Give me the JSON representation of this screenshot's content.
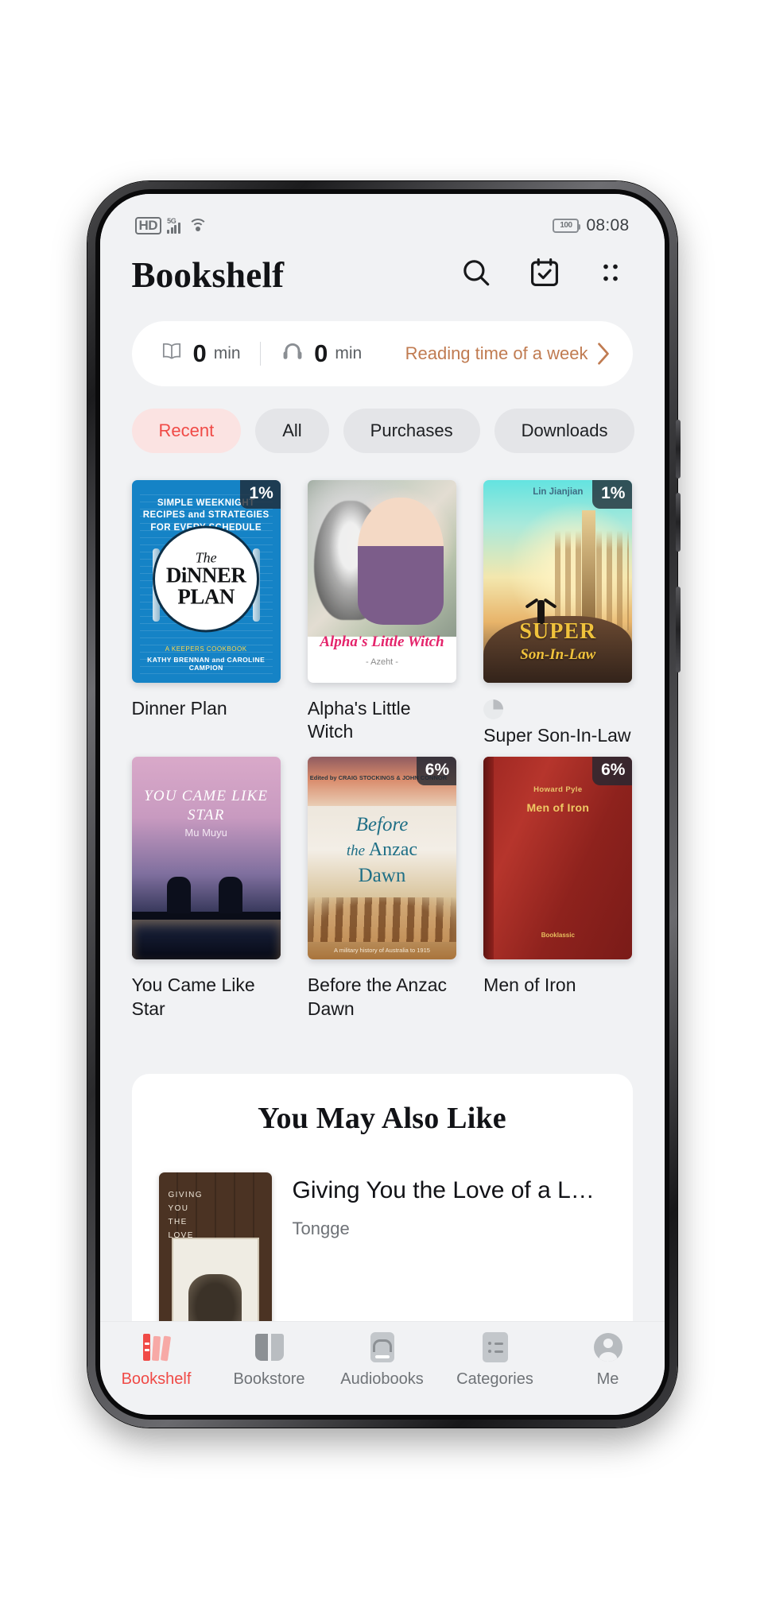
{
  "status_bar": {
    "hd": "HD",
    "network": "5G",
    "wifi_icon": "wifi-icon",
    "battery_level": "100",
    "time": "08:08"
  },
  "header": {
    "title": "Bookshelf",
    "icons": [
      {
        "name": "search-icon",
        "label": "Search"
      },
      {
        "name": "calendar-check-icon",
        "label": "Calendar"
      },
      {
        "name": "more-menu-icon",
        "label": "More"
      }
    ]
  },
  "reading_stats": {
    "read": {
      "value": "0",
      "unit": "min",
      "icon": "open-book-icon"
    },
    "listen": {
      "value": "0",
      "unit": "min",
      "icon": "headphones-icon"
    },
    "link_label": "Reading time of a week",
    "chevron": "chevron-right-icon",
    "accent_color": "#c07b51"
  },
  "filters": {
    "active_index": 0,
    "active_color": "#f04a46",
    "active_bg": "#fbe3e2",
    "items": [
      {
        "label": "Recent"
      },
      {
        "label": "All"
      },
      {
        "label": "Purchases"
      },
      {
        "label": "Downloads"
      }
    ]
  },
  "books": [
    {
      "title": "Dinner Plan",
      "progress_badge": "1%",
      "has_progress_ring": false,
      "cover": {
        "style": "dinner-plan",
        "headline": "SIMPLE WEEKNIGHT RECIPES and STRATEGIES FOR EVERY SCHEDULE",
        "title_line1": "The",
        "title_line2": "DiNNER",
        "title_line3": "PLAN",
        "subtitle": "A KEEPERS COOKBOOK",
        "authors": "KATHY BRENNAN and CAROLINE CAMPION"
      }
    },
    {
      "title": "Alpha's Little Witch",
      "progress_badge": "",
      "has_progress_ring": false,
      "cover": {
        "style": "alphas-little-witch",
        "title_text": "Alpha's Little Witch",
        "author_text": "- Azeht -"
      }
    },
    {
      "title": "Super Son-In-Law",
      "progress_badge": "1%",
      "has_progress_ring": true,
      "cover": {
        "style": "super-son-in-law",
        "author_top": "Lin Jianjian",
        "title_line1": "SUPER",
        "title_line2": "Son-In-Law"
      }
    },
    {
      "title": "You Came Like Star",
      "progress_badge": "",
      "has_progress_ring": false,
      "cover": {
        "style": "you-came-like-star",
        "title_text": "YOU CAME LIKE STAR",
        "author_text": "Mu Muyu"
      }
    },
    {
      "title": "Before the Anzac Dawn",
      "progress_badge": "6%",
      "has_progress_ring": false,
      "cover": {
        "style": "before-the-anzac-dawn",
        "edited_by": "Edited by CRAIG STOCKINGS & JOHN CONNOR",
        "title_line1": "Before",
        "title_line2_italic": "the",
        "title_line2": "Anzac",
        "title_line3": "Dawn",
        "subtitle": "A military history of Australia to 1915"
      }
    },
    {
      "title": "Men of Iron",
      "progress_badge": "6%",
      "has_progress_ring": false,
      "cover": {
        "style": "men-of-iron",
        "author": "Howard Pyle",
        "title_text": "Men of Iron",
        "publisher": "Booklassic"
      }
    }
  ],
  "recommendations": {
    "heading": "You May Also Like",
    "items": [
      {
        "title": "Giving You the Love of a L…",
        "author": "Tongge",
        "cover_lines": [
          "GIVING",
          "YOU",
          "THE",
          "LOVE"
        ]
      }
    ]
  },
  "tabbar": {
    "active_index": 0,
    "active_color": "#f04a46",
    "items": [
      {
        "label": "Bookshelf",
        "icon": "bookshelf-icon"
      },
      {
        "label": "Bookstore",
        "icon": "open-book-icon"
      },
      {
        "label": "Audiobooks",
        "icon": "audiobook-icon"
      },
      {
        "label": "Categories",
        "icon": "categories-list-icon"
      },
      {
        "label": "Me",
        "icon": "user-avatar-icon"
      }
    ]
  }
}
